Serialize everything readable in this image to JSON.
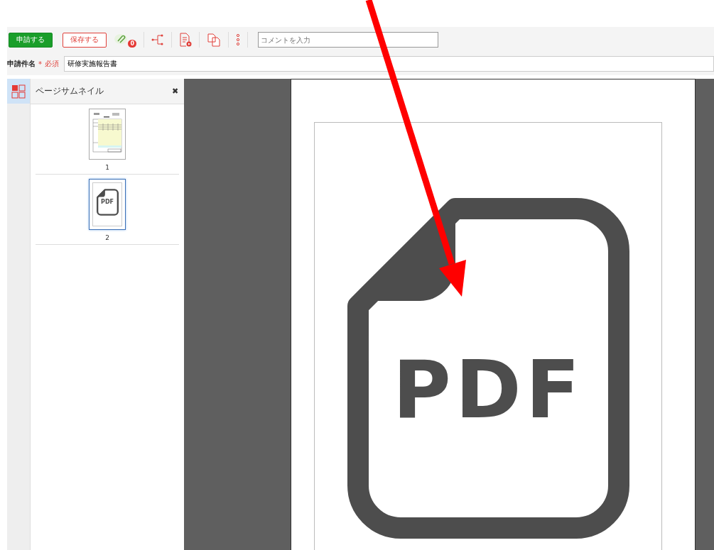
{
  "toolbar": {
    "buttons": [
      {
        "label": "申請する",
        "kind": "primary"
      },
      {
        "label": "保存する",
        "kind": "outline"
      }
    ],
    "attachment_count": "0",
    "comment": {
      "placeholder": "コメントを入力"
    }
  },
  "subject": {
    "label": "申請件名",
    "required_mark": "*",
    "required_text": "必須",
    "value": "研修実施報告書"
  },
  "sidebar": {
    "tools": [
      {
        "selected": true
      }
    ],
    "panel_title": "ページサムネイル",
    "close": "✖",
    "thumbnails": [
      {
        "label": "1",
        "kind": "form",
        "selected": false
      },
      {
        "label": "2",
        "kind": "pdf",
        "text": "PDF",
        "selected": true
      }
    ]
  },
  "viewer": {
    "page_text": "PDF"
  }
}
